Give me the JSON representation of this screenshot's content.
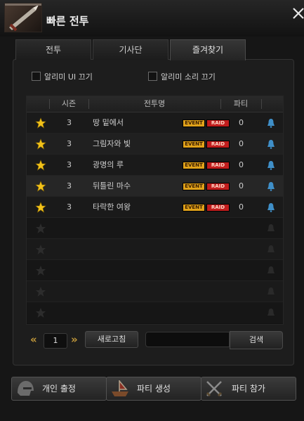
{
  "window": {
    "title": "빠른 전투"
  },
  "tabs": [
    {
      "label": "전투"
    },
    {
      "label": "기사단"
    },
    {
      "label": "즐겨찾기"
    }
  ],
  "options": {
    "ui_off": "알리미 UI 끄기",
    "sound_off": "알리미 소리 끄기"
  },
  "table": {
    "headers": {
      "season": "시즌",
      "name": "전투명",
      "party": "파티"
    },
    "rows": [
      {
        "season": "3",
        "name": "땅 밑에서",
        "event": "EVENT",
        "raid": "RAID",
        "party": "0"
      },
      {
        "season": "3",
        "name": "그림자와 빛",
        "event": "EVENT",
        "raid": "RAID",
        "party": "0"
      },
      {
        "season": "3",
        "name": "광명의 루",
        "event": "EVENT",
        "raid": "RAID",
        "party": "0"
      },
      {
        "season": "3",
        "name": "뒤틀린 마수",
        "event": "EVENT",
        "raid": "RAID",
        "party": "0"
      },
      {
        "season": "3",
        "name": "타락한 여왕",
        "event": "EVENT",
        "raid": "RAID",
        "party": "0"
      }
    ]
  },
  "pager": {
    "prev": "«",
    "page": "1",
    "next": "»"
  },
  "refresh_label": "새로고침",
  "search": {
    "value": "",
    "button": "검색"
  },
  "actions": {
    "solo": "개인 출정",
    "create_party": "파티 생성",
    "join_party": "파티 참가"
  },
  "colors": {
    "star_gold": "#f2c21a",
    "bell_blue": "#3f8fc8",
    "event_badge": "#e0a21a",
    "raid_badge": "#c11d1d",
    "pager_arrow": "#c49a3a"
  }
}
